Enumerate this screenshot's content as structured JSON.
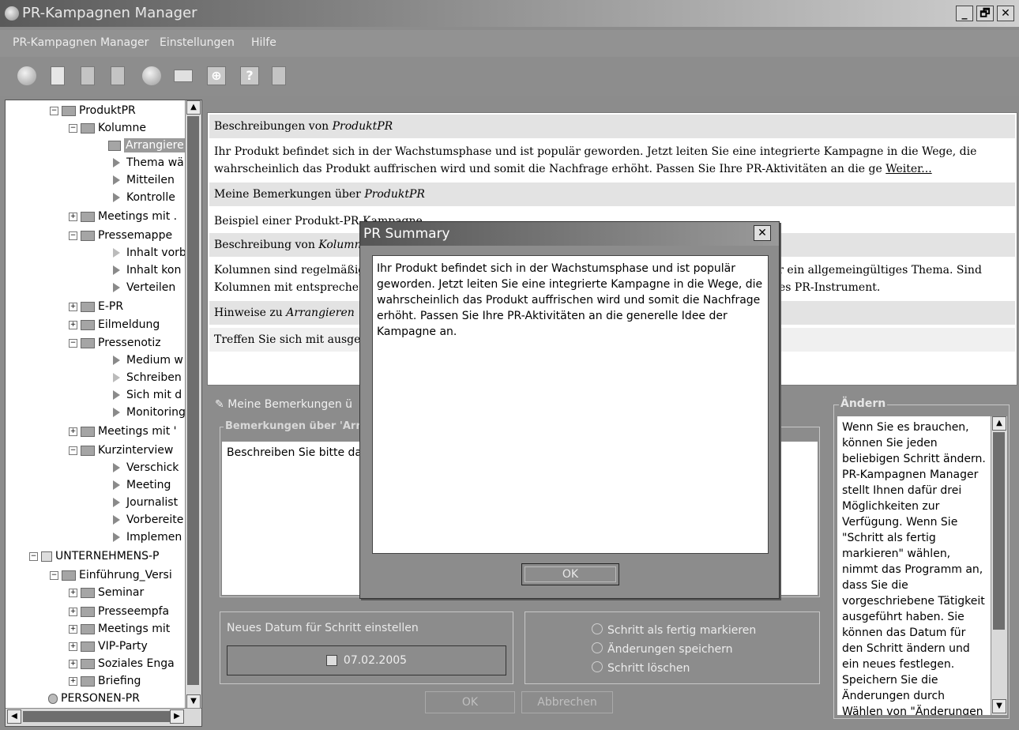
{
  "window": {
    "title": "PR-Kampagnen Manager",
    "minimize": "_",
    "maximize": "🗗",
    "close": "✕"
  },
  "menu": [
    {
      "label": "PR-Kampagnen Manager"
    },
    {
      "label": "Einstellungen"
    },
    {
      "label": "Hilfe"
    }
  ],
  "toolbar": {
    "icons": [
      "disk-icon",
      "new-document-icon",
      "copy-document-icon",
      "delete-document-icon",
      "globe-icon",
      "mail-icon",
      "network-icon",
      "help-icon",
      "exit-icon"
    ],
    "help_symbol": "?"
  },
  "tree": {
    "rows": [
      {
        "label": "ProduktPR"
      },
      {
        "label": "Kolumne"
      },
      {
        "label": "Arrangiere"
      },
      {
        "label": "Thema wä"
      },
      {
        "label": "Mitteilen"
      },
      {
        "label": "Kontrolle"
      },
      {
        "label": "Meetings mit ."
      },
      {
        "label": "Pressemappe"
      },
      {
        "label": "Inhalt vorb"
      },
      {
        "label": "Inhalt kon"
      },
      {
        "label": "Verteilen"
      },
      {
        "label": "E-PR"
      },
      {
        "label": "Eilmeldung"
      },
      {
        "label": "Pressenotiz"
      },
      {
        "label": "Medium w"
      },
      {
        "label": "Schreiben"
      },
      {
        "label": "Sich mit d"
      },
      {
        "label": "Monitoring"
      },
      {
        "label": "Meetings mit '"
      },
      {
        "label": "Kurzinterview"
      },
      {
        "label": "Verschick"
      },
      {
        "label": "Meeting"
      },
      {
        "label": "Journalist"
      },
      {
        "label": "Vorbereite"
      },
      {
        "label": "Implemen"
      },
      {
        "label": "UNTERNEHMENS-P"
      },
      {
        "label": "Einführung_Versi"
      },
      {
        "label": "Seminar"
      },
      {
        "label": "Presseempfa"
      },
      {
        "label": "Meetings mit"
      },
      {
        "label": "VIP-Party"
      },
      {
        "label": "Soziales Enga"
      },
      {
        "label": "Briefing"
      },
      {
        "label": "PERSONEN-PR"
      }
    ],
    "expander_plus": "+",
    "expander_minus": "−",
    "up_arrow": "▲",
    "down_arrow": "▼",
    "left_arrow": "◀",
    "right_arrow": "▶"
  },
  "description": {
    "r1": "Beschreibungen von ",
    "r1_em": "ProduktPR",
    "r2": "Ihr Produkt befindet sich in der Wachstumsphase und ist populär geworden. Jetzt leiten Sie eine integrierte Kampagne in die Wege, die wahrscheinlich das Produkt auffrischen wird und somit die Nachfrage erhöht. Passen Sie Ihre PR-Aktivitäten an die ge ",
    "r2_link": "Weiter...",
    "r3": "Meine Bemerkungen über ",
    "r3_em": "ProduktPR",
    "r4": "Beispiel einer Produkt-PR-Kampagne",
    "r5": "Beschreibung von ",
    "r5_em": "Kolumne",
    "r6a": "Kolumnen sind regelmäßig",
    "r6b": "er ein allgemeingültiges Thema. Sind",
    "r6c": "Kolumnen mit entspreche",
    "r6d": "lles PR-Instrument.",
    "r7": "Hinweise zu ",
    "r7_em": "Arrangieren",
    "r8": "Treffen Sie sich mit ausge"
  },
  "notes": {
    "title": "Meine Bemerkungen ü",
    "group_title": "Bemerkungen über 'Arra",
    "text": "Beschreiben Sie bitte da"
  },
  "date": {
    "label": "Neues Datum für Schritt einstellen",
    "value": "07.02.2005"
  },
  "radios": [
    {
      "label": "Schritt als fertig markieren"
    },
    {
      "label": "Änderungen speichern"
    },
    {
      "label": "Schritt löschen"
    }
  ],
  "buttons": {
    "ok": "OK",
    "cancel": "Abbrechen"
  },
  "help": {
    "title": "Ändern",
    "text": "Wenn Sie es brauchen, können Sie jeden beliebigen Schritt ändern. PR-Kampagnen Manager stellt Ihnen dafür drei Möglichkeiten zur Verfügung. Wenn Sie \"Schritt als fertig markieren\" wählen, nimmt das Programm an, dass Sie die vorgeschriebene Tätigkeit ausgeführt haben. Sie können das Datum für den Schritt ändern und ein neues festlegen. Speichern Sie die Änderungen durch Wählen von \"Änderungen speichern\". Sie können"
  },
  "dialog": {
    "title": "PR Summary",
    "close": "✕",
    "text": "Ihr Produkt befindet sich in der Wachstumsphase und ist populär geworden. Jetzt leiten Sie eine integrierte Kampagne in die Wege, die wahrscheinlich das Produkt auffrischen wird und somit die Nachfrage erhöht. Passen Sie Ihre PR-Aktivitäten an die generelle Idee der Kampagne an.",
    "ok": "OK"
  }
}
